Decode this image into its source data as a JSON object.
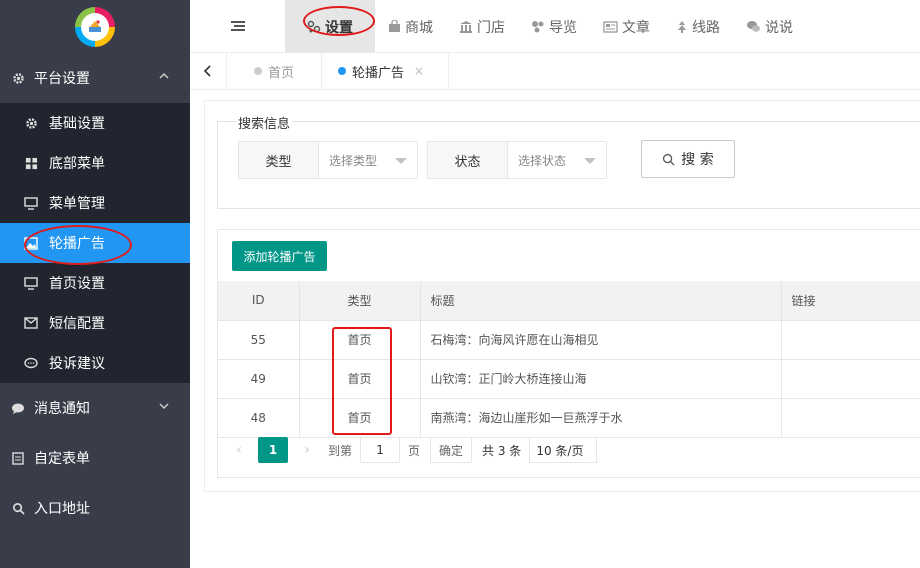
{
  "sidebar": {
    "groups": [
      {
        "label": "平台设置",
        "icon": "gear-icon"
      },
      {
        "label": "消息通知",
        "icon": "chat-bubble-icon"
      },
      {
        "label": "自定表单",
        "icon": "form-icon"
      },
      {
        "label": "入口地址",
        "icon": "search-icon"
      }
    ],
    "items": [
      {
        "label": "基础设置",
        "icon": "gear-icon"
      },
      {
        "label": "底部菜单",
        "icon": "grid-icon"
      },
      {
        "label": "菜单管理",
        "icon": "monitor-icon"
      },
      {
        "label": "轮播广告",
        "icon": "image-icon"
      },
      {
        "label": "首页设置",
        "icon": "monitor-icon"
      },
      {
        "label": "短信配置",
        "icon": "envelope-icon"
      },
      {
        "label": "投诉建议",
        "icon": "speech-icon"
      }
    ]
  },
  "topnav": {
    "items": [
      {
        "label": "设置",
        "icon": "settings-nodes-icon"
      },
      {
        "label": "商城",
        "icon": "bag-icon"
      },
      {
        "label": "门店",
        "icon": "bank-icon"
      },
      {
        "label": "导览",
        "icon": "nodes-icon"
      },
      {
        "label": "文章",
        "icon": "news-icon"
      },
      {
        "label": "线路",
        "icon": "route-icon"
      },
      {
        "label": "说说",
        "icon": "wechat-icon"
      }
    ]
  },
  "tabs": [
    {
      "label": "首页"
    },
    {
      "label": "轮播广告",
      "close": "×"
    }
  ],
  "search": {
    "legend": "搜索信息",
    "type_label": "类型",
    "type_placeholder": "选择类型",
    "status_label": "状态",
    "status_placeholder": "选择状态",
    "button_label": "搜 索"
  },
  "table": {
    "add_button": "添加轮播广告",
    "headers": {
      "id": "ID",
      "type": "类型",
      "title": "标题",
      "link": "链接"
    },
    "rows": [
      {
        "id": "55",
        "type": "首页",
        "title": "石梅湾：向海风许愿在山海相见",
        "link": ""
      },
      {
        "id": "49",
        "type": "首页",
        "title": "山钦湾：正门岭大桥连接山海",
        "link": ""
      },
      {
        "id": "48",
        "type": "首页",
        "title": "南燕湾：海边山崖形如一巨燕浮于水",
        "link": ""
      }
    ]
  },
  "pager": {
    "current": "1",
    "goto_label": "到第",
    "page_input": "1",
    "page_unit": "页",
    "confirm": "确定",
    "total": "共 3 条",
    "page_size": "10 条/页"
  },
  "colors": {
    "sidebar_bg": "#393d49",
    "submenu_bg": "#22252f",
    "selected": "#2196f3",
    "primary": "#009688",
    "highlight_annotation": "#e01b1b"
  }
}
